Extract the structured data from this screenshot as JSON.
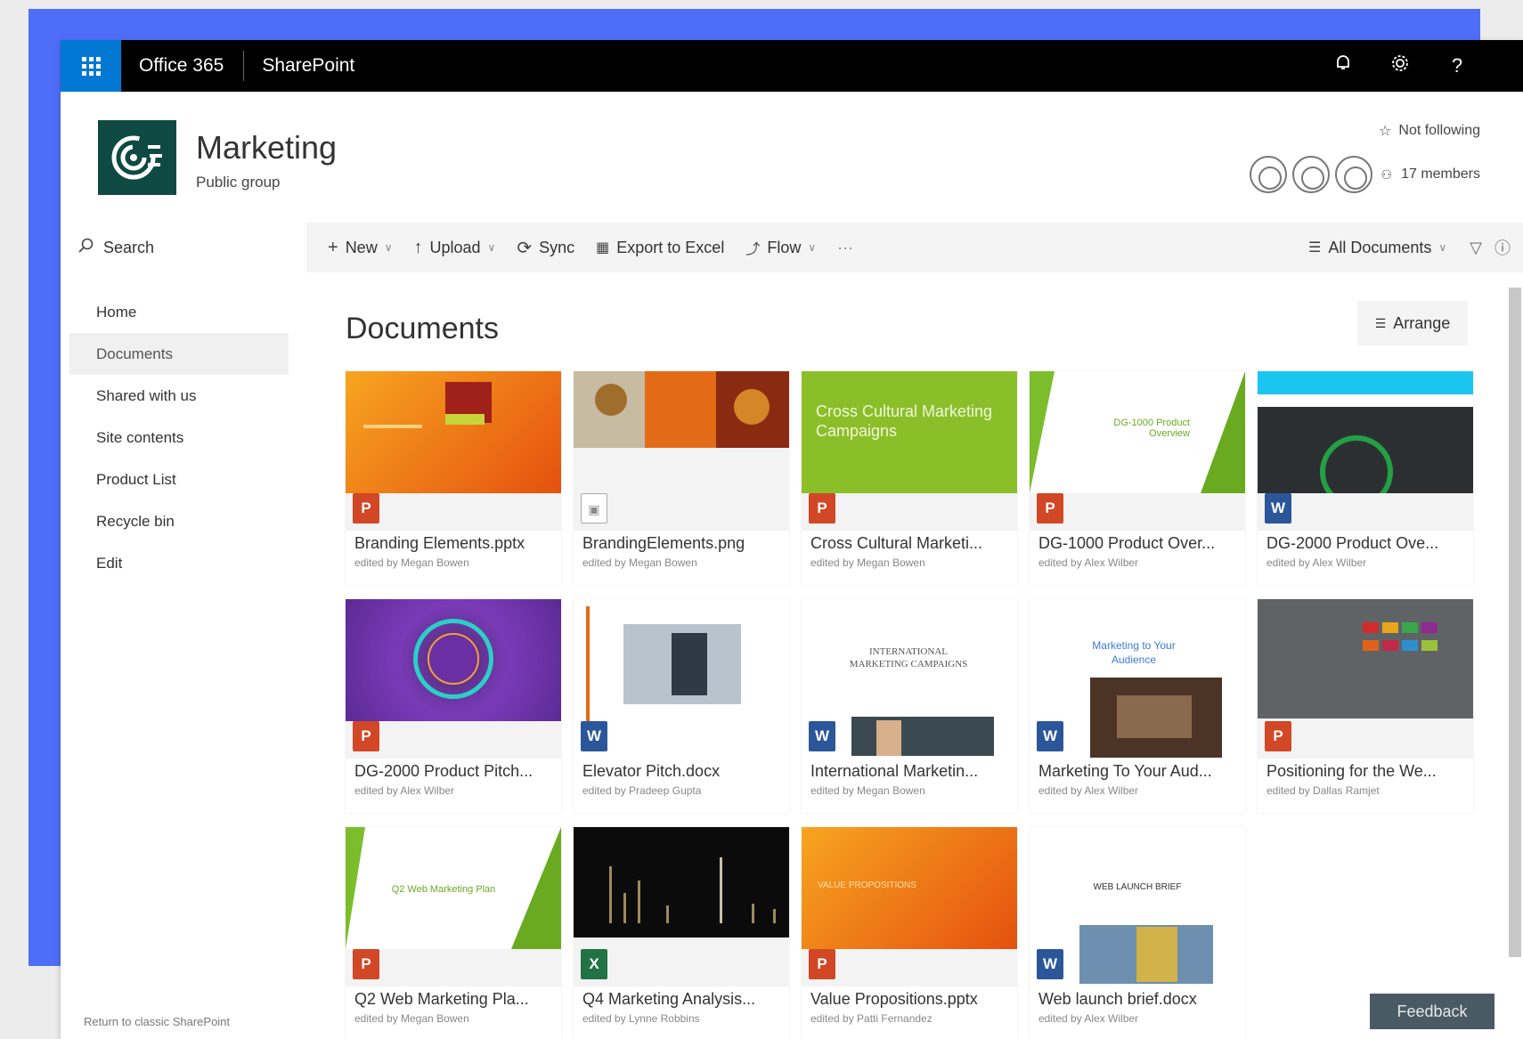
{
  "suite": {
    "title": "Office 365",
    "app": "SharePoint",
    "icons": [
      "bell-icon",
      "gear-icon",
      "help-icon"
    ]
  },
  "site": {
    "title": "Marketing",
    "subtitle": "Public group",
    "follow_label": "Not following",
    "members_label": "17 members"
  },
  "search": {
    "label": "Search"
  },
  "nav": {
    "items": [
      {
        "label": "Home"
      },
      {
        "label": "Documents"
      },
      {
        "label": "Shared with us"
      },
      {
        "label": "Site contents"
      },
      {
        "label": "Product List"
      },
      {
        "label": "Recycle bin"
      },
      {
        "label": "Edit"
      }
    ],
    "selected": "Documents",
    "classic_link": "Return to classic SharePoint"
  },
  "commandbar": {
    "new": "New",
    "upload": "Upload",
    "sync": "Sync",
    "export": "Export to Excel",
    "flow": "Flow",
    "more": "···",
    "view": "All Documents"
  },
  "library": {
    "title": "Documents",
    "arrange_label": "Arrange"
  },
  "tiles": [
    {
      "name": "Branding Elements.pptx",
      "meta": "edited by Megan Bowen",
      "type": "ppt"
    },
    {
      "name": "BrandingElements.png",
      "meta": "edited by Megan Bowen",
      "type": "img"
    },
    {
      "name": "Cross Cultural Marketi...",
      "meta": "edited by Megan Bowen",
      "type": "ppt"
    },
    {
      "name": "DG-1000 Product Over...",
      "meta": "edited by Alex Wilber",
      "type": "ppt"
    },
    {
      "name": "DG-2000 Product Ove...",
      "meta": "edited by Alex Wilber",
      "type": "doc"
    },
    {
      "name": "DG-2000 Product Pitch...",
      "meta": "edited by Alex Wilber",
      "type": "ppt"
    },
    {
      "name": "Elevator Pitch.docx",
      "meta": "edited by Pradeep Gupta",
      "type": "doc"
    },
    {
      "name": "International Marketin...",
      "meta": "edited by Megan Bowen",
      "type": "doc"
    },
    {
      "name": "Marketing To Your Aud...",
      "meta": "edited by Alex Wilber",
      "type": "doc"
    },
    {
      "name": "Positioning for the We...",
      "meta": "edited by Dallas Ramjet",
      "type": "ppt"
    },
    {
      "name": "Q2 Web Marketing Pla...",
      "meta": "edited by Megan Bowen",
      "type": "ppt"
    },
    {
      "name": "Q4 Marketing Analysis...",
      "meta": "edited by Lynne Robbins",
      "type": "xls"
    },
    {
      "name": "Value Propositions.pptx",
      "meta": "edited by Patti Fernandez",
      "type": "ppt"
    },
    {
      "name": "Web launch brief.docx",
      "meta": "edited by Alex Wilber",
      "type": "doc"
    }
  ],
  "thumb_texts": {
    "cross_cultural": "Cross Cultural Marketing Campaigns",
    "dg1000": "DG-1000 Product Overview",
    "international": "INTERNATIONAL MARKETING CAMPAIGNS",
    "marketing_audience": "Marketing to Your Audience",
    "web_launch": "WEB LAUNCH BRIEF",
    "q2": "Q2 Web Marketing Plan",
    "value": "VALUE PROPOSITIONS"
  },
  "feedback": {
    "label": "Feedback"
  },
  "colors": {
    "accent_back": "#4f6ef7",
    "waffle": "#0078d4",
    "site_logo": "#0f4a42",
    "ppt": "#d24726",
    "word": "#2b579a",
    "excel": "#217346"
  }
}
